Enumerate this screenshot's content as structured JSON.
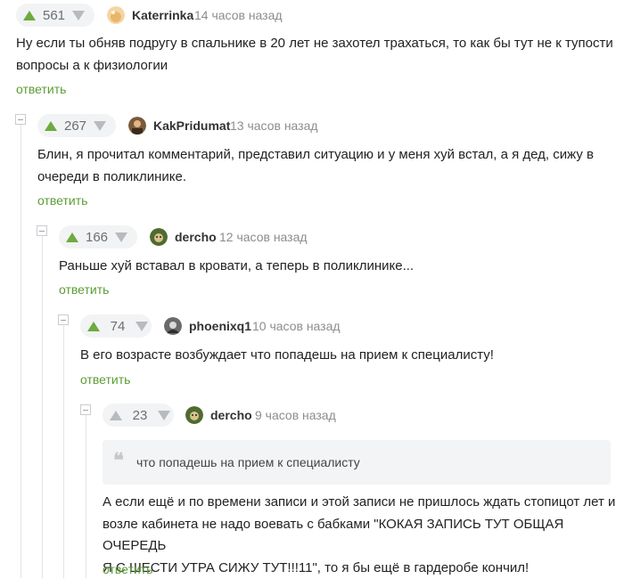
{
  "reply_label": "ответить",
  "comments": [
    {
      "rating": "561",
      "author": "Katerrinka",
      "time": "14 часов назад",
      "lines": [
        "Ну если ты обняв подругу в спальнике в 20 лет не захотел трахаться, то как бы тут не к тупости",
        "вопросы а к физиологии"
      ]
    },
    {
      "rating": "267",
      "author": "KakPridumat",
      "time": "13 часов назад",
      "lines": [
        "Блин, я прочитал комментарий, представил ситуацию и у меня хуй встал, а я дед, сижу в",
        "очереди в поликлинике."
      ]
    },
    {
      "rating": "166",
      "author": "dercho",
      "time": "12 часов назад",
      "lines": [
        "Раньше хуй вставал в кровати, а теперь в поликлинике..."
      ]
    },
    {
      "rating": "74",
      "author": "phoenixq1",
      "time": "10 часов назад",
      "lines": [
        "В его возрасте возбуждает что попадешь на прием к специалисту!"
      ]
    },
    {
      "rating": "23",
      "author": "dercho",
      "time": "9 часов назад",
      "quote": "что попадешь на прием к специалисту",
      "lines": [
        "А если ещё и по времени записи и этой записи не пришлось ждать стопицот лет и",
        "возле кабинета не надо воевать с бабками \"КОКАЯ ЗАПИСЬ ТУТ ОБЩАЯ ОЧЕРЕДЬ",
        "Я С ШЕСТИ УТРА СИЖУ ТУТ!!!11\", то я бы ещё в гардеробе кончил!"
      ]
    }
  ],
  "colors": {
    "upvote": "#6cab3e",
    "downvote": "#b7bbbf",
    "reply_link": "#5b9c34",
    "vote_bg": "#f2f3f4"
  },
  "icons": {
    "upvote": "triangle-up",
    "downvote": "triangle-down",
    "collapse": "minus-square",
    "quote": "quote-mark"
  }
}
